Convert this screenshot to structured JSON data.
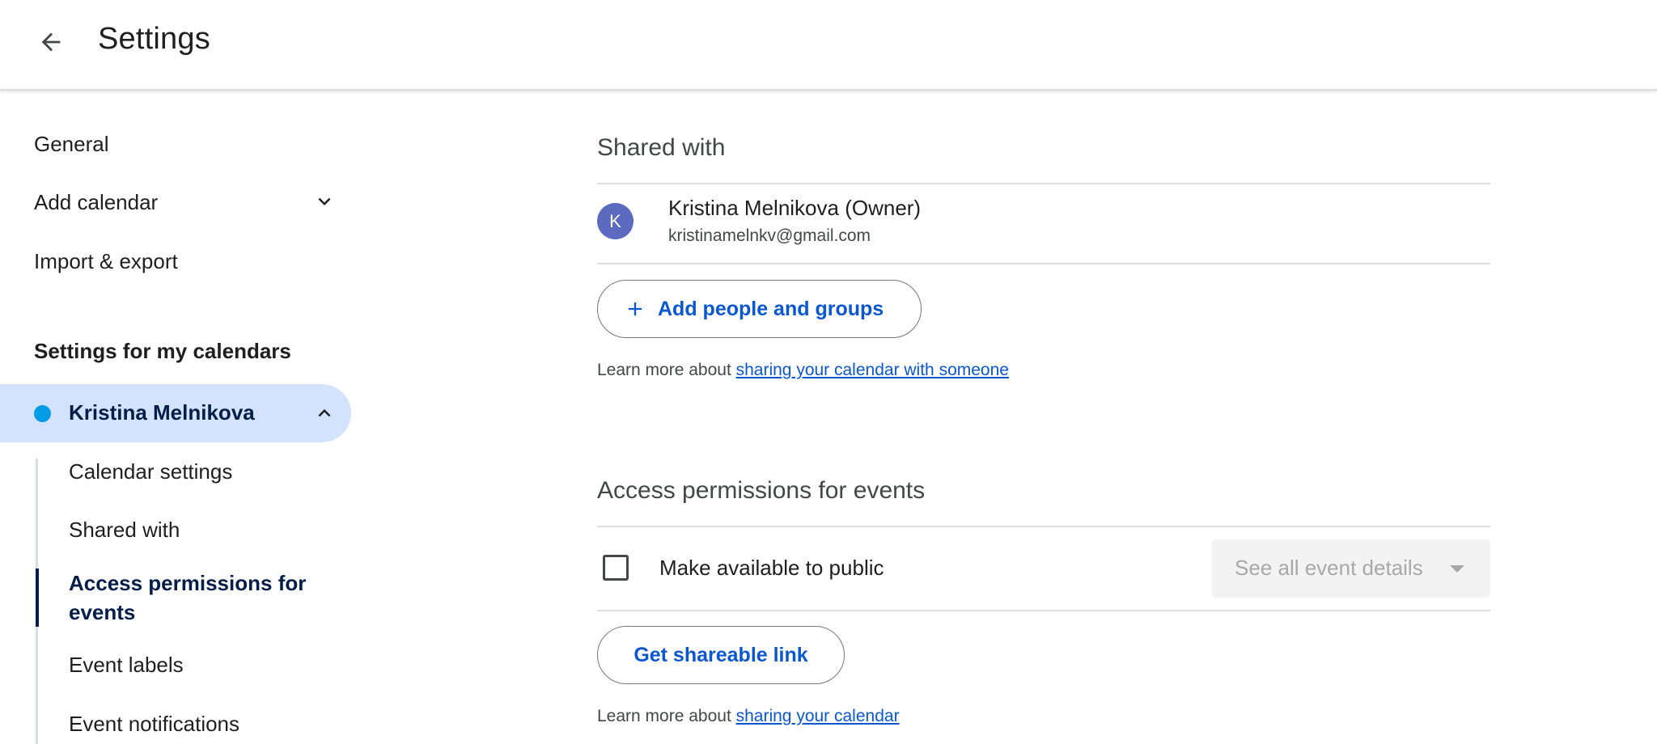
{
  "header": {
    "title": "Settings",
    "back_icon": "arrow-back-icon"
  },
  "sidebar": {
    "general": "General",
    "add_calendar": "Add calendar",
    "import_export": "Import & export",
    "section_heading": "Settings for my calendars",
    "calendar": {
      "name": "Kristina Melnikova",
      "color": "#039be5"
    },
    "sub_items": [
      "Calendar settings",
      "Shared with",
      "Access permissions for events",
      "Event labels",
      "Event notifications"
    ]
  },
  "main": {
    "shared_with": {
      "heading": "Shared with",
      "owner": {
        "initial": "K",
        "name": "Kristina Melnikova (Owner)",
        "email": "kristinamelnkv@gmail.com"
      },
      "add_button": "Add people and groups",
      "learn_prefix": "Learn more about ",
      "learn_link": "sharing your calendar with someone"
    },
    "access": {
      "heading": "Access permissions for events",
      "checkbox_label": "Make available to public",
      "checked": false,
      "select_value": "See all event details",
      "link_button": "Get shareable link",
      "learn_prefix": "Learn more about ",
      "learn_link": "sharing your calendar"
    }
  }
}
